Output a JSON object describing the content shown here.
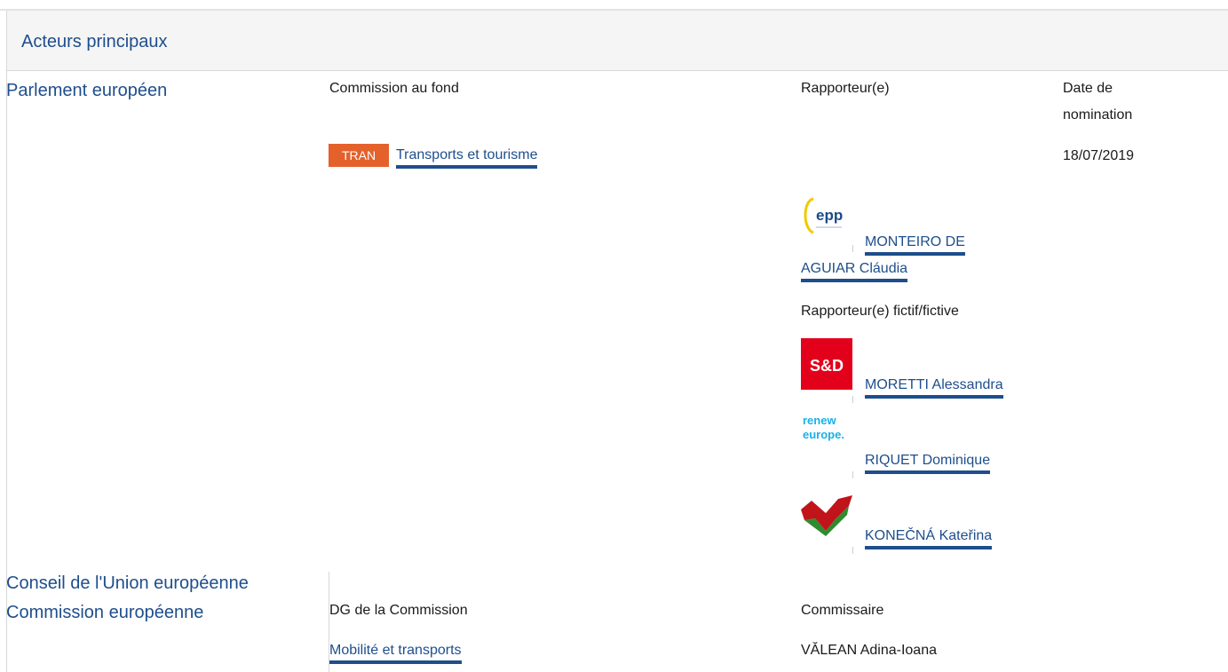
{
  "section": {
    "title": "Acteurs principaux"
  },
  "parliament": {
    "name": "Parlement européen",
    "headers": {
      "committee": "Commission au fond",
      "rapporteur": "Rapporteur(e)",
      "date_line1": "Date de",
      "date_line2": "nomination"
    },
    "committee": {
      "code": "TRAN",
      "name": "Transports et tourisme",
      "badge_color": "#e4612b"
    },
    "date": "18/07/2019",
    "rapporteur": {
      "logo": "epp-logo",
      "logo_text": "epp",
      "name_line1": "MONTEIRO DE",
      "name_line2": "AGUIAR Cláudia"
    },
    "shadow_label": "Rapporteur(e) fictif/fictive",
    "shadows": [
      {
        "logo": "sd-logo",
        "logo_text": "S&D",
        "name": "MORETTI Alessandra"
      },
      {
        "logo": "renew-logo",
        "logo_text_1": "renew",
        "logo_text_2": "europe.",
        "name": "RIQUET Dominique"
      },
      {
        "logo": "gue-logo",
        "name": "KONEČNÁ Kateřina"
      }
    ]
  },
  "council": {
    "name": "Conseil de l'Union européenne"
  },
  "commission": {
    "name": "Commission européenne",
    "dg_label": "DG de la Commission",
    "dg_value": "Mobilité et transports",
    "commissioner_label": "Commissaire",
    "commissioner_value": "VĂLEAN Adina-Ioana"
  },
  "colors": {
    "link": "#1e4e8c",
    "badge": "#e4612b",
    "header_bg": "#f5f5f5"
  }
}
